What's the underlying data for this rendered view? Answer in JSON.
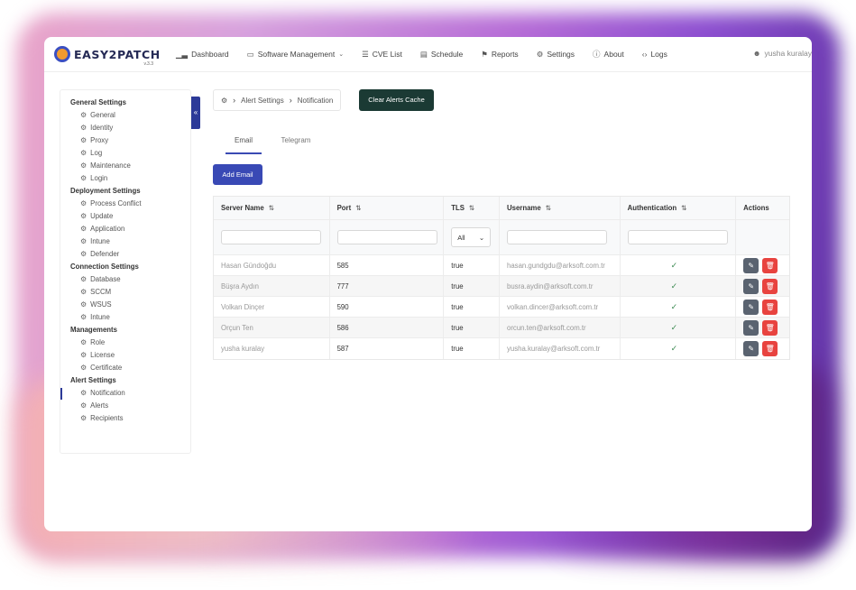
{
  "app": {
    "logo_text": "EASY2PATCH",
    "version": "v.3.3"
  },
  "nav": [
    {
      "label": "Dashboard",
      "icon": "chart-icon"
    },
    {
      "label": "Software Management",
      "icon": "monitor-icon",
      "has_caret": true
    },
    {
      "label": "CVE List",
      "icon": "list-icon"
    },
    {
      "label": "Schedule",
      "icon": "calendar-icon"
    },
    {
      "label": "Reports",
      "icon": "flag-icon"
    },
    {
      "label": "Settings",
      "icon": "gear-icon"
    },
    {
      "label": "About",
      "icon": "info-icon"
    },
    {
      "label": "Logs",
      "icon": "code-icon"
    }
  ],
  "user": {
    "name": "yusha kuralay"
  },
  "sidebar": {
    "sections": [
      {
        "title": "General Settings",
        "items": [
          "General",
          "Identity",
          "Proxy",
          "Log",
          "Maintenance",
          "Login"
        ]
      },
      {
        "title": "Deployment Settings",
        "items": [
          "Process Conflict",
          "Update",
          "Application",
          "Intune",
          "Defender"
        ]
      },
      {
        "title": "Connection Settings",
        "items": [
          "Database",
          "SCCM",
          "WSUS",
          "Intune"
        ]
      },
      {
        "title": "Managements",
        "items": [
          "Role",
          "License",
          "Certificate"
        ]
      },
      {
        "title": "Alert Settings",
        "items": [
          "Notification",
          "Alerts",
          "Recipients"
        ]
      }
    ],
    "active_item": "Notification"
  },
  "breadcrumb": {
    "section": "Alert Settings",
    "page": "Notification"
  },
  "buttons": {
    "clear_cache": "Clear Alerts Cache",
    "add_email": "Add Email"
  },
  "tabs": [
    {
      "label": "Email",
      "active": true
    },
    {
      "label": "Telegram",
      "active": false
    }
  ],
  "table": {
    "headers": [
      "Server Name",
      "Port",
      "TLS",
      "Username",
      "Authentication",
      "Actions"
    ],
    "tls_filter": "All",
    "rows": [
      {
        "server": "Hasan Gündoğdu",
        "port": "585",
        "tls": "true",
        "username": "hasan.gundgdu@arksoft.com.tr",
        "auth": true
      },
      {
        "server": "Büşra Aydın",
        "port": "777",
        "tls": "true",
        "username": "busra.aydin@arksoft.com.tr",
        "auth": true
      },
      {
        "server": "Volkan Dinçer",
        "port": "590",
        "tls": "true",
        "username": "volkan.dincer@arksoft.com.tr",
        "auth": true
      },
      {
        "server": "Orçun Ten",
        "port": "586",
        "tls": "true",
        "username": "orcun.ten@arksoft.com.tr",
        "auth": true
      },
      {
        "server": "yusha kuralay",
        "port": "587",
        "tls": "true",
        "username": "yusha.kuralay@arksoft.com.tr",
        "auth": true
      }
    ]
  },
  "colors": {
    "primary": "#3949b5",
    "dark_button": "#1b3a34",
    "delete": "#e8433f",
    "edit": "#5a6370",
    "check": "#3c8a52"
  }
}
